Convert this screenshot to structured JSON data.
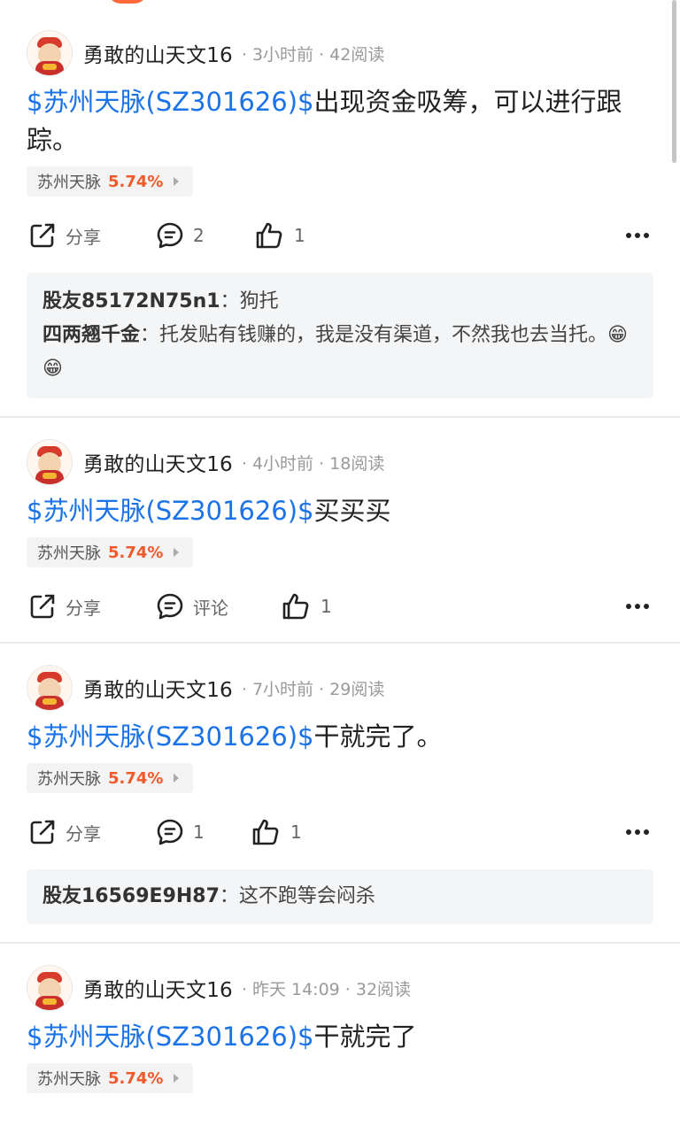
{
  "posts": [
    {
      "username": "勇敢的山天文16",
      "meta": "· 3小时前 · 42阅读",
      "stock_link": "$苏州天脉(SZ301626)$",
      "text": "出现资金吸筹，可以进行跟踪。",
      "tag": {
        "name": "苏州天脉",
        "pct": "5.74%"
      },
      "actions": {
        "share": "分享",
        "comment": "2",
        "like": "1"
      },
      "comments": [
        {
          "author": "股友85172N75n1",
          "sep": "：",
          "text": "狗托"
        },
        {
          "author": "四两翘千金",
          "sep": "：",
          "text": "托发贴有钱赚的，我是没有渠道，不然我也去当托。😁😁"
        }
      ]
    },
    {
      "username": "勇敢的山天文16",
      "meta": "· 4小时前 · 18阅读",
      "stock_link": "$苏州天脉(SZ301626)$",
      "text": "买买买",
      "tag": {
        "name": "苏州天脉",
        "pct": "5.74%"
      },
      "actions": {
        "share": "分享",
        "comment": "评论",
        "like": "1"
      }
    },
    {
      "username": "勇敢的山天文16",
      "meta": "· 7小时前 · 29阅读",
      "stock_link": "$苏州天脉(SZ301626)$",
      "text": "干就完了。",
      "tag": {
        "name": "苏州天脉",
        "pct": "5.74%"
      },
      "actions": {
        "share": "分享",
        "comment": "1",
        "like": "1"
      },
      "comments": [
        {
          "author": "股友16569E9H87",
          "sep": "：",
          "text": "这不跑等会闷杀"
        }
      ]
    },
    {
      "username": "勇敢的山天文16",
      "meta": "· 昨天 14:09 · 32阅读",
      "stock_link": "$苏州天脉(SZ301626)$",
      "text": "干就完了",
      "tag": {
        "name": "苏州天脉",
        "pct": "5.74%"
      }
    }
  ],
  "colors": {
    "link": "#1a73e8",
    "pct_up": "#f0592a",
    "meta": "#999999"
  },
  "icons": [
    "share-icon",
    "comment-icon",
    "like-icon",
    "more-icon",
    "chevron-right-icon"
  ]
}
